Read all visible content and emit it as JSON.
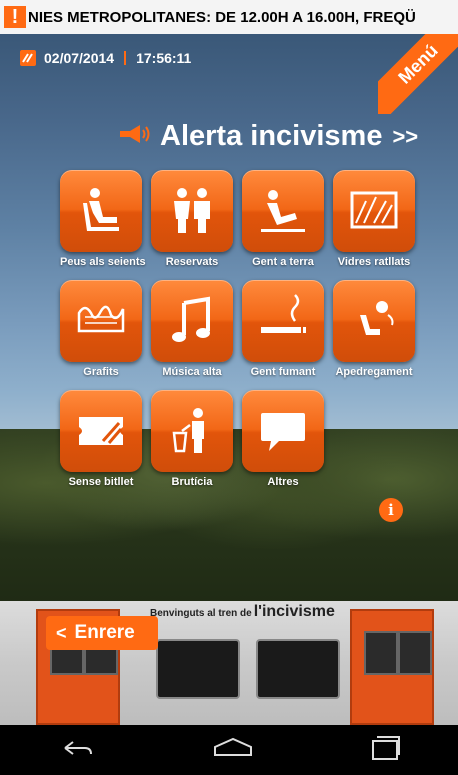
{
  "ticker": {
    "alert_icon": "!",
    "text": "NIES METROPOLITANES: DE 12.00H A 16.00H, FREQÜ"
  },
  "status": {
    "date": "02/07/2014",
    "time": "17:56:11"
  },
  "menu": {
    "label": "Menú"
  },
  "headline": {
    "title": "Alerta incivisme",
    "chevron": ">>"
  },
  "tiles": [
    {
      "label": "Peus als seients",
      "icon": "feet-on-seat-icon"
    },
    {
      "label": "Reservats",
      "icon": "reserved-seats-icon"
    },
    {
      "label": "Gent a terra",
      "icon": "people-on-floor-icon"
    },
    {
      "label": "Vidres ratllats",
      "icon": "scratched-glass-icon"
    },
    {
      "label": "Grafits",
      "icon": "graffiti-icon"
    },
    {
      "label": "Música alta",
      "icon": "music-note-icon"
    },
    {
      "label": "Gent fumant",
      "icon": "smoking-icon"
    },
    {
      "label": "Apedregament",
      "icon": "stone-throwing-icon"
    },
    {
      "label": "Sense bitllet",
      "icon": "no-ticket-icon"
    },
    {
      "label": "Brutícia",
      "icon": "litter-icon"
    },
    {
      "label": "Altres",
      "icon": "speech-bubble-icon"
    }
  ],
  "info": {
    "label": "i"
  },
  "train": {
    "banner_small": "Benvinguts al tren de",
    "banner_big": "l'incivisme"
  },
  "back": {
    "label": "Enrere",
    "arrow": "<"
  },
  "colors": {
    "accent": "#ff6a13"
  }
}
